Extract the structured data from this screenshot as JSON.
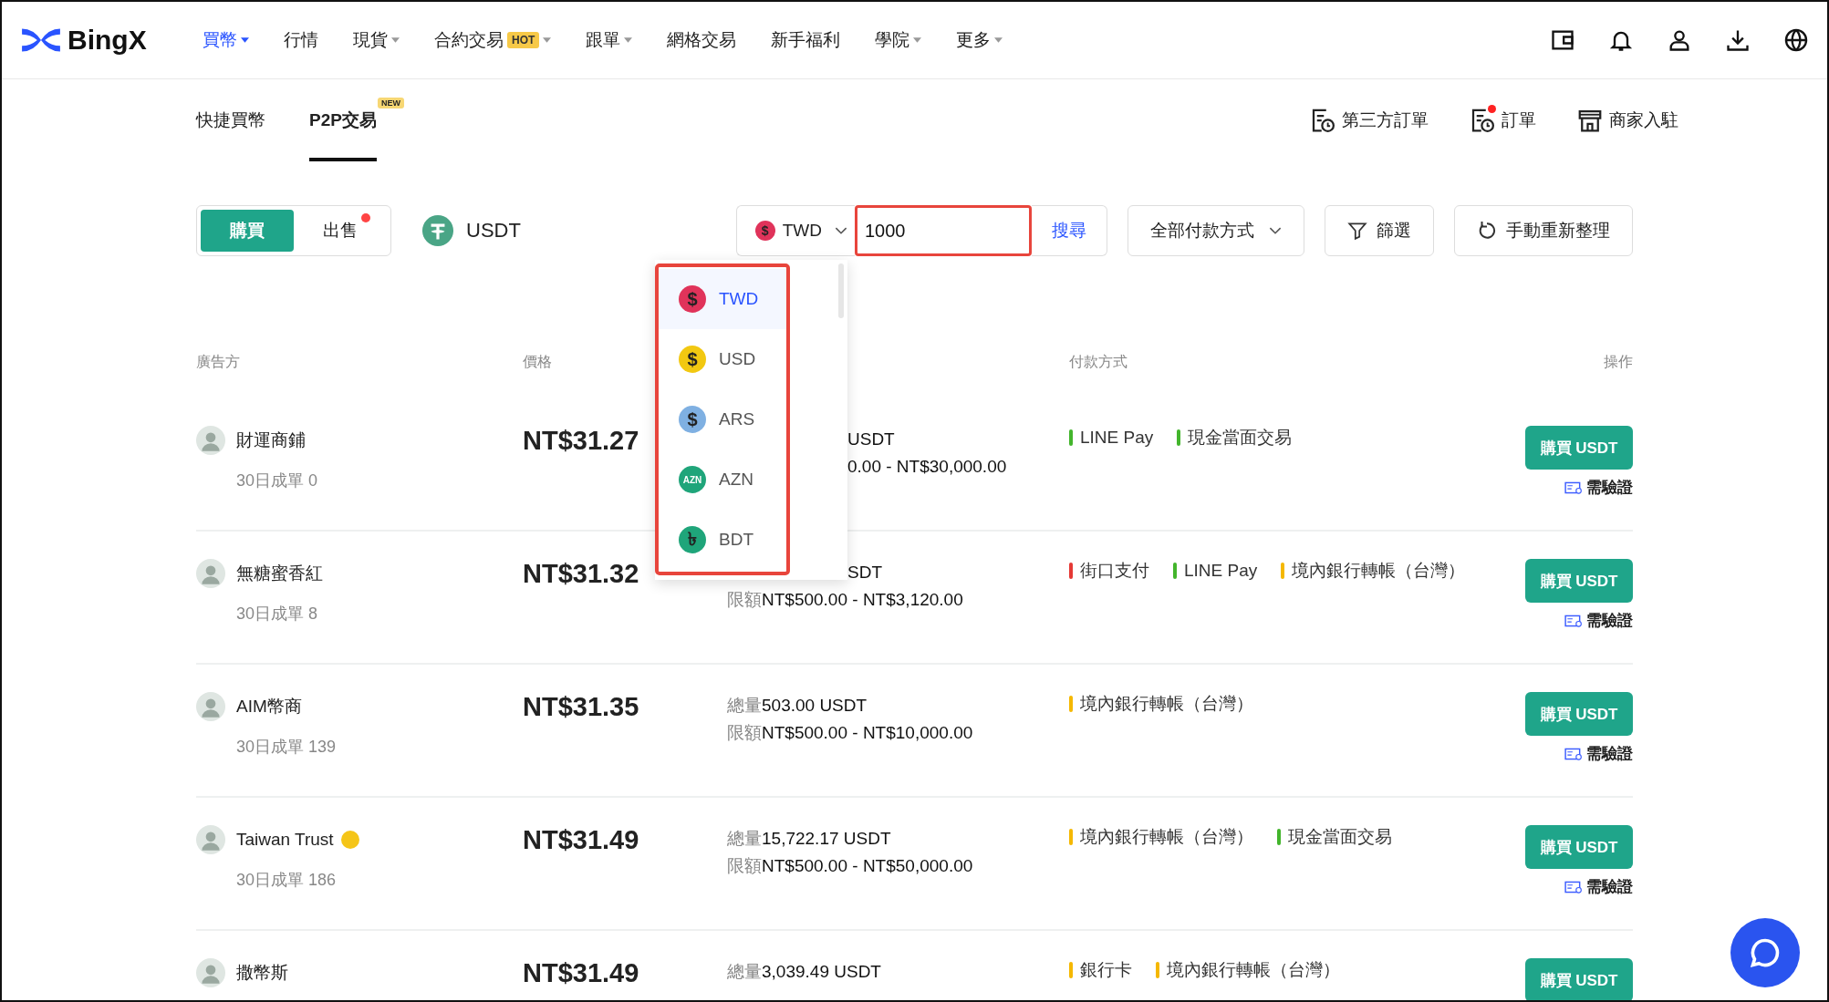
{
  "logo": "BingX",
  "nav": [
    {
      "label": "買幣",
      "selected": true,
      "caret": true
    },
    {
      "label": "行情",
      "selected": false,
      "caret": false
    },
    {
      "label": "現貨",
      "selected": false,
      "caret": true
    },
    {
      "label": "合約交易",
      "selected": false,
      "caret": true,
      "badge": "HOT"
    },
    {
      "label": "跟單",
      "selected": false,
      "caret": true
    },
    {
      "label": "網格交易",
      "selected": false,
      "caret": false
    },
    {
      "label": "新手福利",
      "selected": false,
      "caret": false
    },
    {
      "label": "學院",
      "selected": false,
      "caret": true
    },
    {
      "label": "更多",
      "selected": false,
      "caret": true
    }
  ],
  "subnav": {
    "tabs": [
      {
        "label": "快捷買幣",
        "selected": false
      },
      {
        "label": "P2P交易",
        "selected": true,
        "badge": "NEW"
      }
    ],
    "links": [
      {
        "label": "第三方訂單",
        "kind": "orders",
        "dot": false
      },
      {
        "label": "訂單",
        "kind": "orders",
        "dot": true
      },
      {
        "label": "商家入駐",
        "kind": "store",
        "dot": false
      }
    ]
  },
  "toolbar": {
    "sides": [
      {
        "label": "購買",
        "selected": true,
        "dot": false
      },
      {
        "label": "出售",
        "selected": false,
        "dot": true
      }
    ],
    "asset": "USDT",
    "currency": {
      "label": "TWD",
      "icon_text": "$",
      "color": "#e0335a"
    },
    "amount": {
      "value": "1000",
      "highlighted": true
    },
    "search_button": "搜尋",
    "payment_filter": "全部付款方式",
    "filter_button": "篩選",
    "refresh_button": "手動重新整理"
  },
  "currency_dropdown": {
    "highlighted": true,
    "items": [
      {
        "label": "TWD",
        "icon_text": "$",
        "color": "#e0335a",
        "selected": true
      },
      {
        "label": "USD",
        "icon_text": "$",
        "color": "#f2c811",
        "selected": false
      },
      {
        "label": "ARS",
        "icon_text": "$",
        "color": "#7fb0e2",
        "selected": false
      },
      {
        "label": "AZN",
        "icon_text": "AZN",
        "color": "#1fa57a",
        "selected": false
      },
      {
        "label": "BDT",
        "icon_text": "৳",
        "color": "#1fa57a",
        "selected": false
      }
    ]
  },
  "table": {
    "columns": {
      "advertiser": "廣告方",
      "price": "價格",
      "payment": "付款方式",
      "action": "操作"
    },
    "rows": [
      {
        "name": "財運商鋪",
        "verified": false,
        "orders": "30日成單 0",
        "price": "NT$31.27",
        "total": {
          "value": "USDT",
          "clipped": true
        },
        "limit": {
          "value": "0.00 - NT$30,000.00",
          "clipped": true
        },
        "payments": [
          {
            "label": "LINE Pay",
            "color": "#43b52c"
          },
          {
            "label": "現金當面交易",
            "color": "#43b52c"
          }
        ],
        "action": "購買 USDT",
        "verify": "需驗證"
      },
      {
        "name": "無糖蜜香紅",
        "verified": false,
        "orders": "30日成單 8",
        "price": "NT$31.32",
        "total": {
          "value": "SDT",
          "clipped": true
        },
        "limit": {
          "label": "限額",
          "value": "NT$500.00 - NT$3,120.00",
          "clipped": false
        },
        "payments": [
          {
            "label": "街口支付",
            "color": "#e53935"
          },
          {
            "label": "LINE Pay",
            "color": "#43b52c"
          },
          {
            "label": "境內銀行轉帳（台灣）",
            "color": "#f5b800"
          }
        ],
        "action": "購買 USDT",
        "verify": "需驗證"
      },
      {
        "name": "AIM幣商",
        "verified": false,
        "orders": "30日成單 139",
        "price": "NT$31.35",
        "total": {
          "label": "總量",
          "value": "503.00 USDT",
          "clipped": false
        },
        "limit": {
          "label": "限額",
          "value": "NT$500.00 - NT$10,000.00",
          "clipped": false
        },
        "payments": [
          {
            "label": "境內銀行轉帳（台灣）",
            "color": "#f5b800"
          }
        ],
        "action": "購買 USDT",
        "verify": "需驗證"
      },
      {
        "name": "Taiwan Trust",
        "verified": true,
        "orders": "30日成單 186",
        "price": "NT$31.49",
        "total": {
          "label": "總量",
          "value": "15,722.17 USDT",
          "clipped": false
        },
        "limit": {
          "label": "限額",
          "value": "NT$500.00 - NT$50,000.00",
          "clipped": false
        },
        "payments": [
          {
            "label": "境內銀行轉帳（台灣）",
            "color": "#f5b800"
          },
          {
            "label": "現金當面交易",
            "color": "#43b52c"
          }
        ],
        "action": "購買 USDT",
        "verify": "需驗證"
      },
      {
        "name": "撒幣斯",
        "verified": false,
        "price": "NT$31.49",
        "total": {
          "label": "總量",
          "value": "3,039.49 USDT",
          "clipped": false
        },
        "payments": [
          {
            "label": "銀行卡",
            "color": "#f5b800"
          },
          {
            "label": "境內銀行轉帳（台灣）",
            "color": "#f5b800"
          }
        ],
        "action": "購買 USDT"
      }
    ]
  }
}
